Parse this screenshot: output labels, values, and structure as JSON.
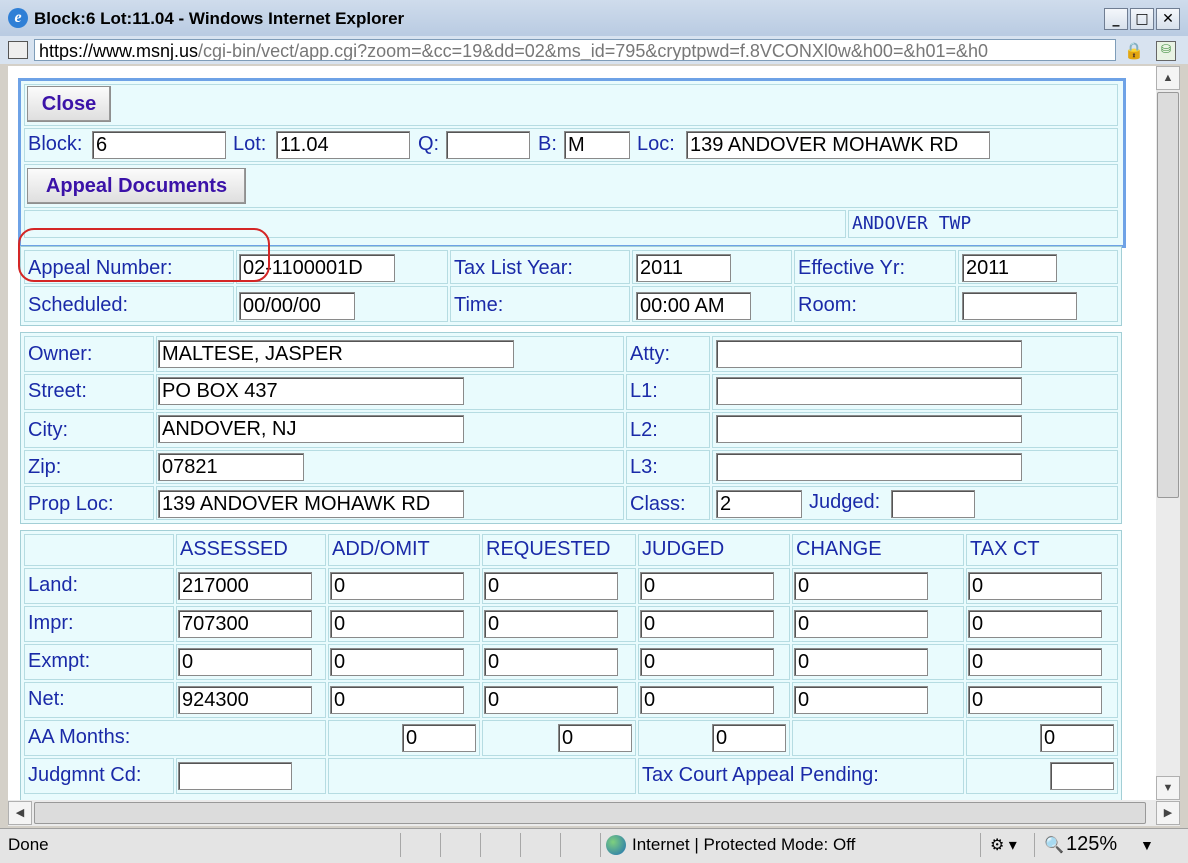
{
  "window": {
    "title": "Block:6 Lot:11.04 - Windows Internet Explorer",
    "url_prefix": "https://www.",
    "url_domain": "msnj.us",
    "url_rest": "/cgi-bin/vect/app.cgi?zoom=&cc=19&dd=02&ms_id=795&cryptpwd=f.8VCONXl0w&h00=&h01=&h0"
  },
  "toolbar": {
    "close_label": "Close",
    "appeal_docs_label": "Appeal Documents"
  },
  "parcel": {
    "block_label": "Block:",
    "block": "6",
    "lot_label": "Lot:",
    "lot": "11.04",
    "q_label": "Q:",
    "q": "",
    "b_label": "B:",
    "b": "M",
    "loc_label": "Loc:",
    "loc": "139 ANDOVER MOHAWK RD",
    "township": "ANDOVER  TWP"
  },
  "appeal": {
    "number_label": "Appeal Number:",
    "number": "02-1100001D",
    "taxyear_label": "Tax List Year:",
    "taxyear": "2011",
    "effyr_label": "Effective Yr:",
    "effyr": "2011",
    "scheduled_label": "Scheduled:",
    "scheduled": "00/00/00",
    "time_label": "Time:",
    "time": "00:00 AM",
    "room_label": "Room:",
    "room": ""
  },
  "owner": {
    "owner_label": "Owner:",
    "owner": "MALTESE, JASPER",
    "street_label": "Street:",
    "street": "PO BOX 437",
    "city_label": "City:",
    "city": "ANDOVER, NJ",
    "zip_label": "Zip:",
    "zip": "07821",
    "proploc_label": "Prop Loc:",
    "proploc": "139 ANDOVER MOHAWK RD",
    "atty_label": "Atty:",
    "atty": "",
    "l1_label": "L1:",
    "l1": "",
    "l2_label": "L2:",
    "l2": "",
    "l3_label": "L3:",
    "l3": "",
    "class_label": "Class:",
    "class": "2",
    "judged_label": "Judged:",
    "judged": ""
  },
  "values": {
    "headers": [
      "ASSESSED",
      "ADD/OMIT",
      "REQUESTED",
      "JUDGED",
      "CHANGE",
      "TAX CT"
    ],
    "rows": [
      {
        "label": "Land:",
        "cells": [
          "217000",
          "0",
          "0",
          "0",
          "0",
          "0"
        ]
      },
      {
        "label": "Impr:",
        "cells": [
          "707300",
          "0",
          "0",
          "0",
          "0",
          "0"
        ]
      },
      {
        "label": "Exmpt:",
        "cells": [
          "0",
          "0",
          "0",
          "0",
          "0",
          "0"
        ]
      },
      {
        "label": "Net:",
        "cells": [
          "924300",
          "0",
          "0",
          "0",
          "0",
          "0"
        ]
      }
    ],
    "aa_label": "AA Months:",
    "aa": [
      "0",
      "0",
      "0",
      "0"
    ],
    "judgmnt_label": "Judgmnt Cd:",
    "judgmnt": "",
    "taxcourt_label": "Tax Court Appeal Pending:",
    "taxcourt": ""
  },
  "status": {
    "done": "Done",
    "zone": "Internet | Protected Mode: Off",
    "zoom": "125%"
  }
}
